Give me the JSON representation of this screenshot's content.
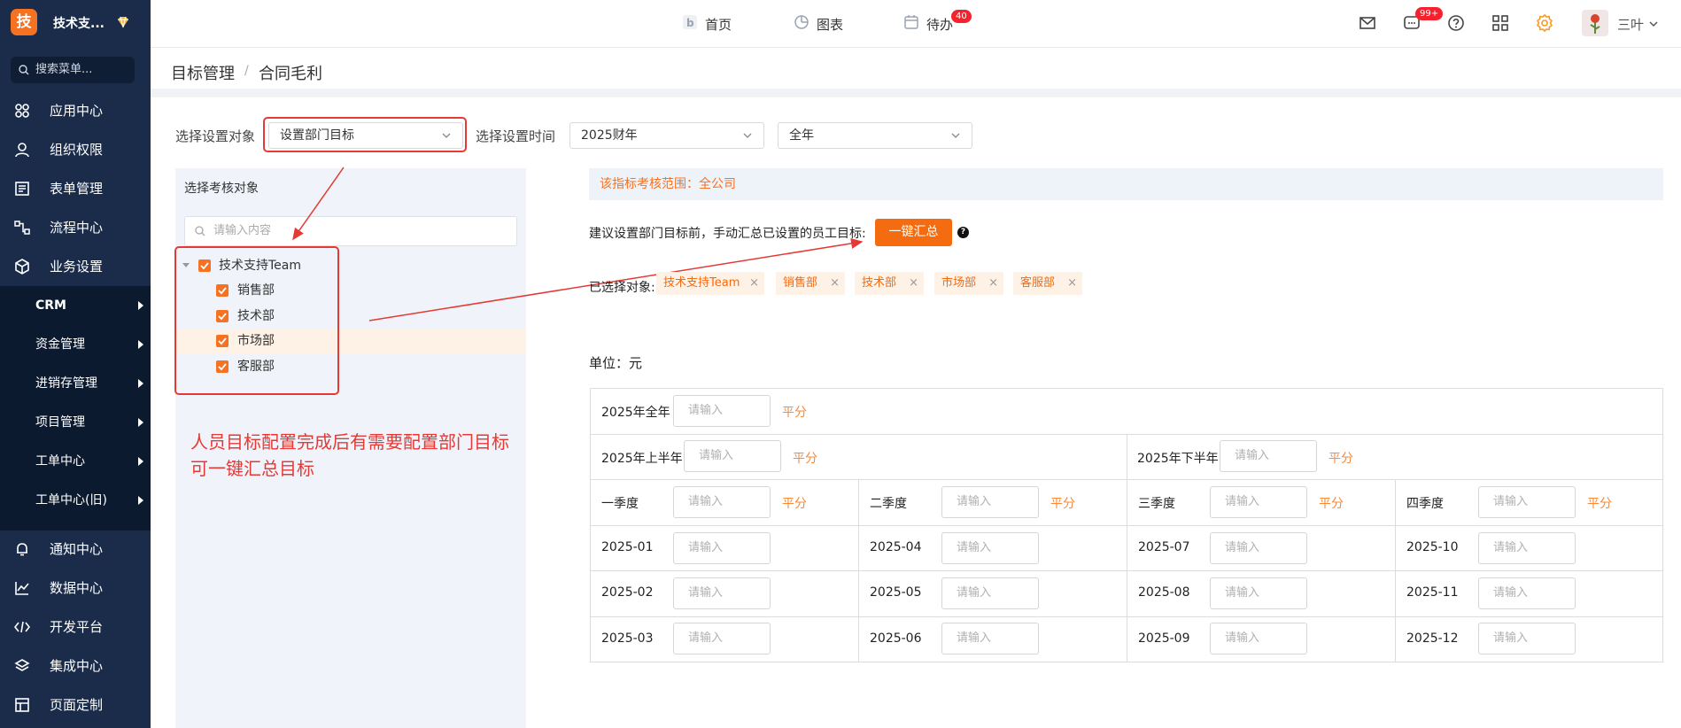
{
  "sidebar": {
    "logo_char": "技",
    "app_name": "技术支...",
    "search_placeholder": "搜索菜单...",
    "items_top": [
      {
        "label": "应用中心",
        "icon": "grid-icon"
      },
      {
        "label": "组织权限",
        "icon": "user-icon"
      },
      {
        "label": "表单管理",
        "icon": "form-icon"
      },
      {
        "label": "流程中心",
        "icon": "flow-icon"
      },
      {
        "label": "业务设置",
        "icon": "cube-icon"
      }
    ],
    "sub_items": [
      {
        "label": "CRM"
      },
      {
        "label": "资金管理"
      },
      {
        "label": "进销存管理"
      },
      {
        "label": "项目管理"
      },
      {
        "label": "工单中心"
      },
      {
        "label": "工单中心(旧)"
      }
    ],
    "items_bottom": [
      {
        "label": "通知中心",
        "icon": "bell-icon"
      },
      {
        "label": "数据中心",
        "icon": "chart-icon"
      },
      {
        "label": "开发平台",
        "icon": "code-icon"
      },
      {
        "label": "集成中心",
        "icon": "layers-icon"
      },
      {
        "label": "页面定制",
        "icon": "layout-icon"
      }
    ]
  },
  "topbar": {
    "home": "首页",
    "charts": "图表",
    "todo": "待办",
    "todo_badge": "40",
    "msg_badge": "99+",
    "user_name": "三叶"
  },
  "breadcrumb": {
    "parent": "目标管理",
    "separator": "/",
    "current": "合同毛利"
  },
  "filters": {
    "object_label": "选择设置对象",
    "object_value": "设置部门目标",
    "time_label": "选择设置时间",
    "year_value": "2025财年",
    "period_value": "全年"
  },
  "left_panel": {
    "title": "选择考核对象",
    "search_placeholder": "请输入内容",
    "tree": {
      "root": "技术支持Team",
      "children": [
        "销售部",
        "技术部",
        "市场部",
        "客服部"
      ]
    }
  },
  "annotation": {
    "line1": "人员目标配置完成后有需要配置部门目标",
    "line2": "可一键汇总目标"
  },
  "main": {
    "scope_info": "该指标考核范围：全公司",
    "hint": "建议设置部门目标前，手动汇总已设置的员工目标:",
    "summary_button": "一键汇总",
    "help": "?",
    "selected_label": "已选择对象:",
    "selected_tags": [
      "技术支持Team",
      "销售部",
      "技术部",
      "市场部",
      "客服部"
    ],
    "tag_close": "×",
    "unit": "单位：元",
    "input_placeholder": "请输入",
    "even_split": "平分",
    "full_year": "2025年全年",
    "h1": "2025年上半年",
    "h2": "2025年下半年",
    "quarters": [
      "一季度",
      "二季度",
      "三季度",
      "四季度"
    ],
    "months": [
      [
        "2025-01",
        "2025-04",
        "2025-07",
        "2025-10"
      ],
      [
        "2025-02",
        "2025-05",
        "2025-08",
        "2025-11"
      ],
      [
        "2025-03",
        "2025-06",
        "2025-09",
        "2025-12"
      ]
    ]
  },
  "colors": {
    "accent": "#f57222",
    "sidebar": "#1a2c4a",
    "annotation": "#e53935"
  }
}
